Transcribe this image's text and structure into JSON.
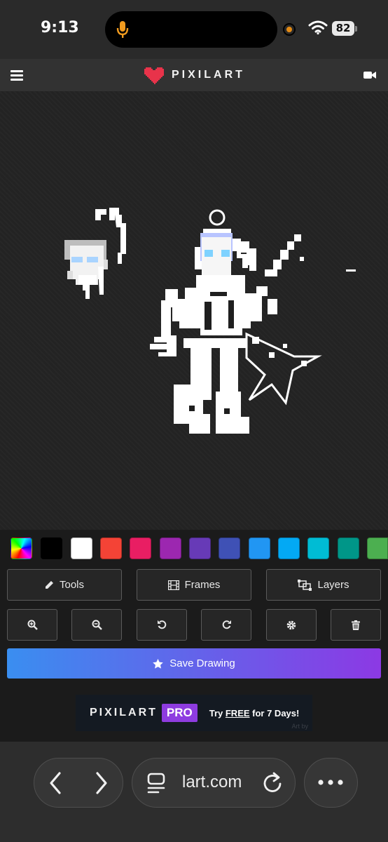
{
  "status_bar": {
    "time": "9:13",
    "battery": "82"
  },
  "app": {
    "name": "PIXILART"
  },
  "palette": [
    "rainbow",
    "#000000",
    "#ffffff",
    "#f44336",
    "#e91e63",
    "#9c27b0",
    "#673ab7",
    "#3f51b5",
    "#2196f3",
    "#03a9f4",
    "#00bcd4",
    "#009688",
    "#4caf50"
  ],
  "toolbar": {
    "tools_label": "Tools",
    "frames_label": "Frames",
    "layers_label": "Layers"
  },
  "actions": {
    "save_label": "Save Drawing"
  },
  "ad": {
    "brand": "PIXILART",
    "pro": "PRO",
    "cta_pre": "Try ",
    "cta_free": "FREE",
    "cta_post": " for 7 Days!",
    "watermark": "Art by"
  },
  "browser": {
    "url": "lart.com"
  }
}
